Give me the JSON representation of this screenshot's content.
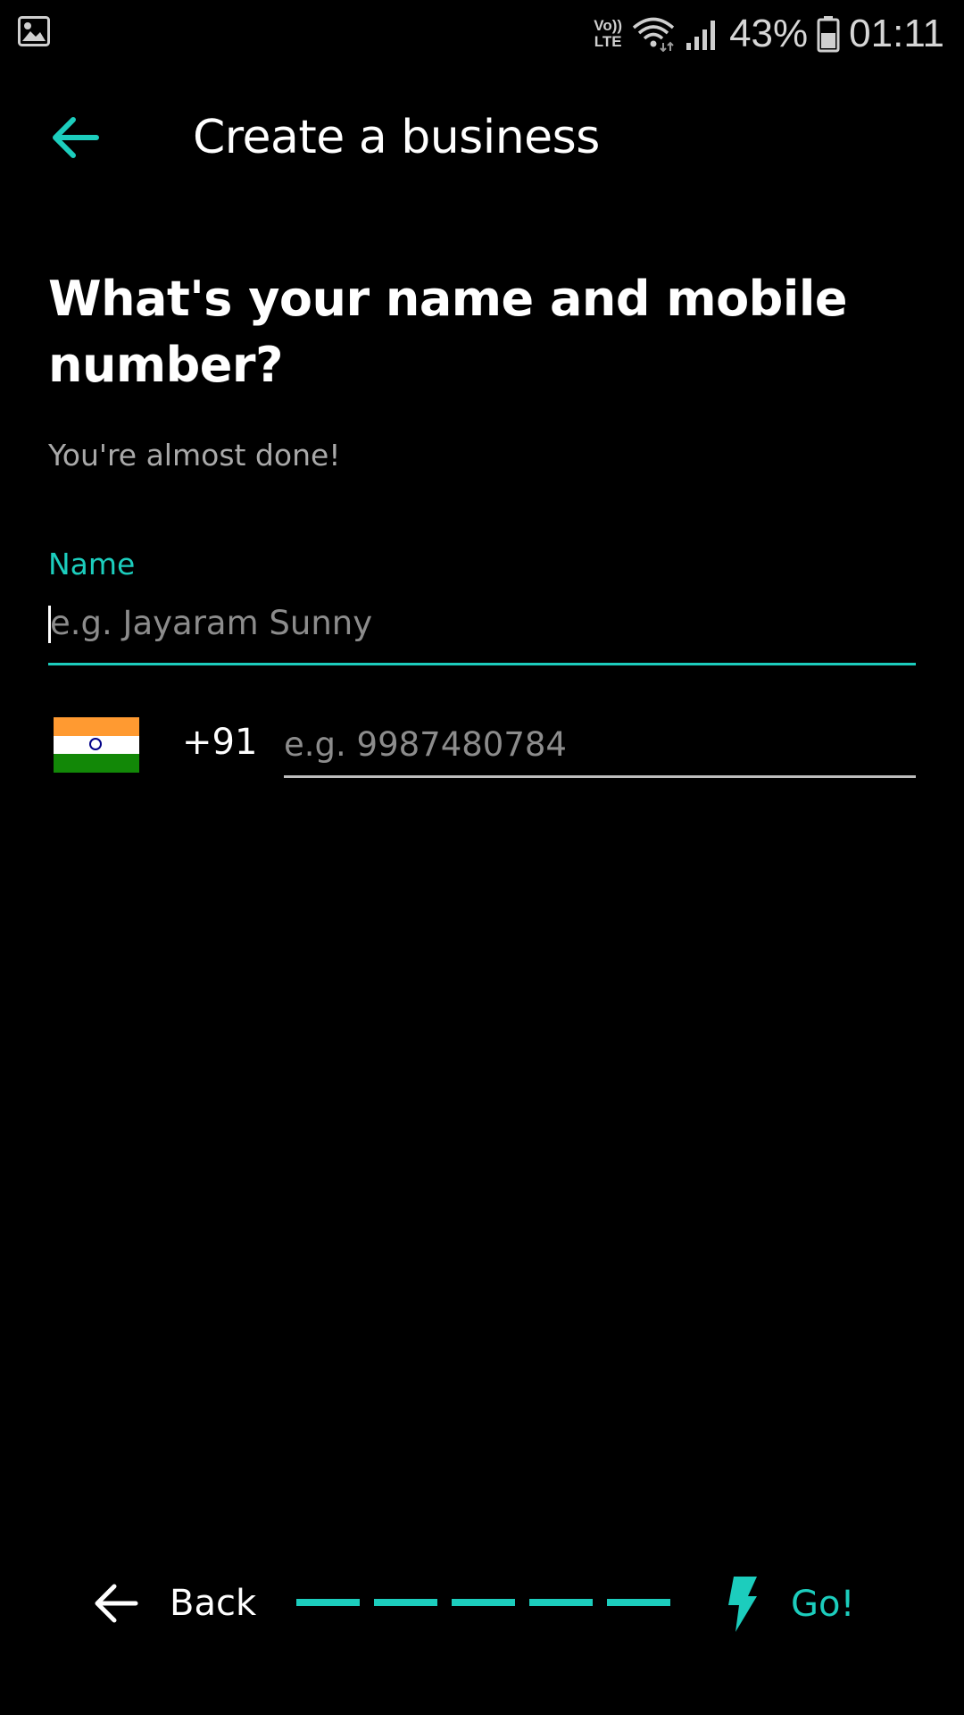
{
  "status_bar": {
    "gallery_icon": "image-icon",
    "volte_line1": "Vo))",
    "volte_line2": "LTE",
    "battery_percent": "43%",
    "time": "01:11"
  },
  "header": {
    "back_icon": "arrow-left-icon",
    "title": "Create a business"
  },
  "main": {
    "headline": "What's your name and mobile number?",
    "subtitle": "You're almost done!",
    "name_field": {
      "label": "Name",
      "value": "",
      "placeholder": "e.g. Jayaram Sunny"
    },
    "phone_field": {
      "country_flag": "india-flag-icon",
      "country_code": "+91",
      "value": "",
      "placeholder": "e.g. 9987480784"
    }
  },
  "footer": {
    "back_label": "Back",
    "progress_segments": 5,
    "go_label": "Go!",
    "go_icon": "lightning-bolt-icon"
  },
  "colors": {
    "accent": "#1ccdbd",
    "background": "#000000",
    "text_primary": "#ffffff",
    "text_secondary": "#a9a9a9"
  }
}
